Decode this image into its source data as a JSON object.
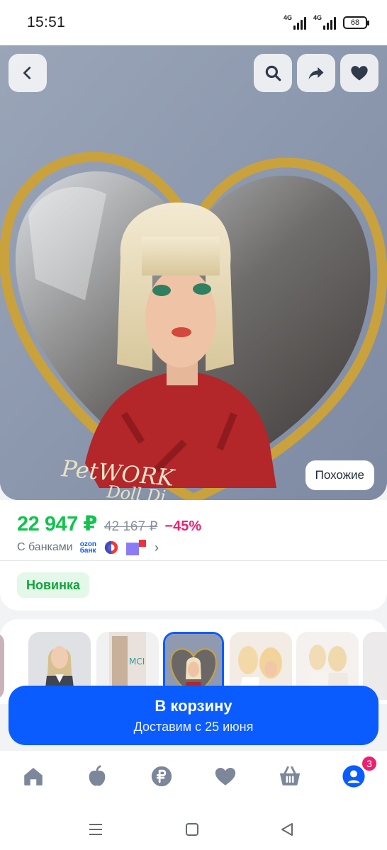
{
  "status_bar": {
    "time": "15:51",
    "network_1": "4G",
    "network_2": "4G",
    "battery": "68"
  },
  "hero": {
    "icons": [
      "back-icon",
      "search-icon",
      "share-icon",
      "heart-icon"
    ],
    "similar_label": "Похожие",
    "box_text_1": "PetWORK",
    "box_text_2": "Doll Di"
  },
  "price": {
    "current": "22 947 ₽",
    "old": "42 167 ₽",
    "discount": "−45%",
    "banks_label": "С банками",
    "ozon_bank_line1": "ozon",
    "ozon_bank_line2": "банк"
  },
  "badge": {
    "label": "Новинка"
  },
  "thumbnails": {
    "selected_index": 3,
    "count": 6
  },
  "cart": {
    "title": "В корзину",
    "subtitle": "Доставим с 25 июня"
  },
  "bottom_nav": {
    "items": [
      "home-icon",
      "fresh-icon",
      "ruble-icon",
      "favorites-icon",
      "cart-basket-icon",
      "profile-icon"
    ],
    "profile_badge": "3"
  },
  "colors": {
    "accent": "#0a5cff",
    "price_green": "#10c44c",
    "discount_pink": "#f01f6e",
    "badge_bg": "#e3f8e9"
  }
}
